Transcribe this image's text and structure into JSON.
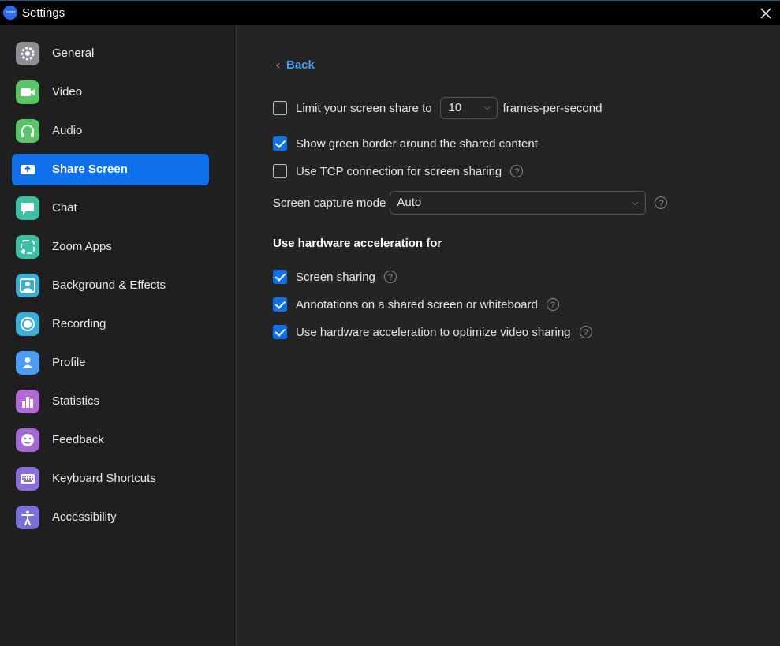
{
  "window": {
    "title": "Settings",
    "logo_text": "zoom"
  },
  "sidebar": {
    "items": [
      {
        "label": "General",
        "icon": "gear-icon",
        "color": "#8e8e93",
        "active": false
      },
      {
        "label": "Video",
        "icon": "video-icon",
        "color": "#58c566",
        "active": false
      },
      {
        "label": "Audio",
        "icon": "headphones-icon",
        "color": "#58c566",
        "active": false
      },
      {
        "label": "Share Screen",
        "icon": "share-screen-icon",
        "color": "#0e71eb",
        "active": true
      },
      {
        "label": "Chat",
        "icon": "chat-icon",
        "color": "#3cc0a5",
        "active": false
      },
      {
        "label": "Zoom Apps",
        "icon": "apps-icon",
        "color": "#3cc0a5",
        "active": false
      },
      {
        "label": "Background & Effects",
        "icon": "background-icon",
        "color": "#3aaed8",
        "active": false
      },
      {
        "label": "Recording",
        "icon": "record-icon",
        "color": "#3aaed8",
        "active": false
      },
      {
        "label": "Profile",
        "icon": "profile-icon",
        "color": "#4b9cf5",
        "active": false
      },
      {
        "label": "Statistics",
        "icon": "statistics-icon",
        "color": "#b06ad6",
        "active": false
      },
      {
        "label": "Feedback",
        "icon": "feedback-icon",
        "color": "#a468d6",
        "active": false
      },
      {
        "label": "Keyboard Shortcuts",
        "icon": "keyboard-icon",
        "color": "#8a6fd8",
        "active": false
      },
      {
        "label": "Accessibility",
        "icon": "accessibility-icon",
        "color": "#7a6fd8",
        "active": false
      }
    ]
  },
  "content": {
    "back_label": "Back",
    "limit_fps": {
      "label": "Limit your screen share to",
      "value": "10",
      "suffix": "frames-per-second",
      "checked": false
    },
    "green_border": {
      "label": "Show green border around the shared content",
      "checked": true
    },
    "tcp": {
      "label": "Use TCP connection for screen sharing",
      "checked": false
    },
    "capture_mode": {
      "label": "Screen capture mode",
      "value": "Auto"
    },
    "hw_section_title": "Use hardware acceleration for",
    "hw_options": [
      {
        "label": "Screen sharing",
        "checked": true
      },
      {
        "label": "Annotations on a shared screen or whiteboard",
        "checked": true
      },
      {
        "label": "Use hardware acceleration to optimize video sharing",
        "checked": true
      }
    ],
    "help_glyph": "?"
  }
}
